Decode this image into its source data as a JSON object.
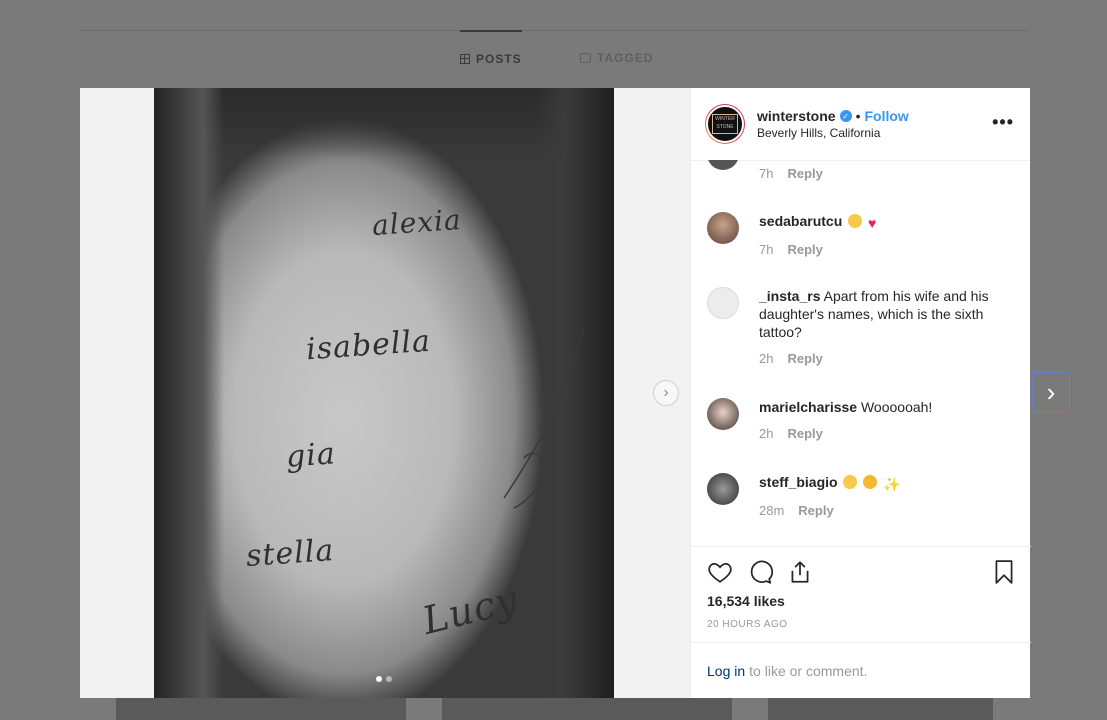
{
  "profile_tabs": {
    "posts": "POSTS",
    "tagged": "TAGGED"
  },
  "post": {
    "username": "winterstone",
    "follow_label": "Follow",
    "separator": "•",
    "location": "Beverly Hills, California",
    "more_label": "•••",
    "tattoo_words": [
      "alexia",
      "isabella",
      "gia",
      "stella",
      "Lucy"
    ],
    "carousel": {
      "count": 2,
      "active_index": 0
    }
  },
  "comments": [
    {
      "user": "",
      "text": "",
      "time": "7h",
      "reply": "Reply"
    },
    {
      "user": "sedabarutcu",
      "text": "",
      "emojis": [
        "grin",
        "heart"
      ],
      "time": "7h",
      "reply": "Reply"
    },
    {
      "user": "_insta_rs",
      "text": "Apart from his wife and his daughter's names, which is the sixth tattoo?",
      "time": "2h",
      "reply": "Reply"
    },
    {
      "user": "marielcharisse",
      "text": "Woooooah!",
      "time": "2h",
      "reply": "Reply"
    },
    {
      "user": "steff_biagio",
      "text": "",
      "emojis": [
        "scream",
        "star-struck",
        "sparkles"
      ],
      "time": "28m",
      "reply": "Reply"
    }
  ],
  "actions": {
    "likes": "16,534 likes",
    "posted": "20 HOURS AGO"
  },
  "login": {
    "link": "Log in",
    "text": "to like or comment."
  },
  "colors": {
    "link": "#3897f0",
    "muted": "#999999",
    "text": "#262626"
  }
}
